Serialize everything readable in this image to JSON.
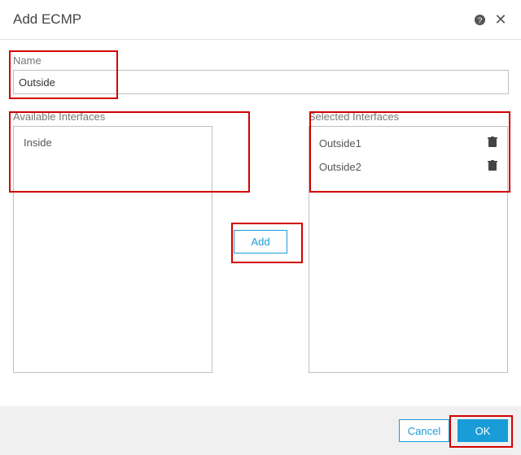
{
  "dialog": {
    "title": "Add ECMP"
  },
  "name": {
    "label": "Name",
    "value": "Outside"
  },
  "available": {
    "label": "Available Interfaces",
    "items": [
      "Inside"
    ]
  },
  "selected": {
    "label": "Selected Interfaces",
    "items": [
      "Outside1",
      "Outside2"
    ]
  },
  "buttons": {
    "add": "Add",
    "cancel": "Cancel",
    "ok": "OK"
  }
}
